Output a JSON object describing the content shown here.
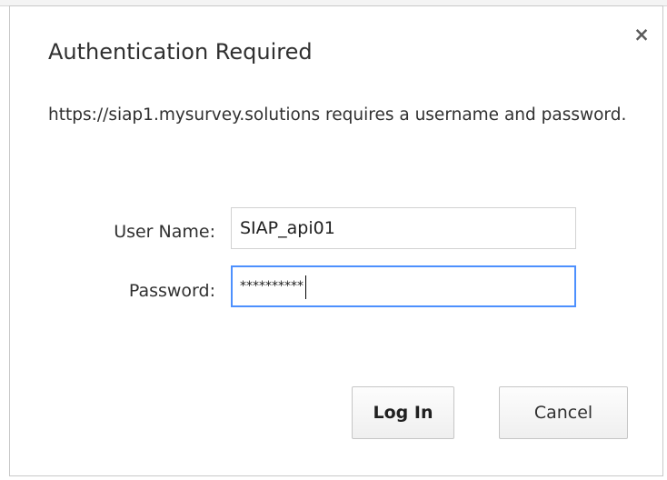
{
  "dialog": {
    "title": "Authentication Required",
    "message": "https://siap1.mysurvey.solutions requires a username and password.",
    "close_glyph": "×"
  },
  "form": {
    "username_label": "User Name:",
    "username_value": "SIAP_api01",
    "password_label": "Password:",
    "password_mask": "**********"
  },
  "buttons": {
    "login": "Log In",
    "cancel": "Cancel"
  },
  "colors": {
    "focus_border": "#4d90fe",
    "text": "#303030"
  }
}
